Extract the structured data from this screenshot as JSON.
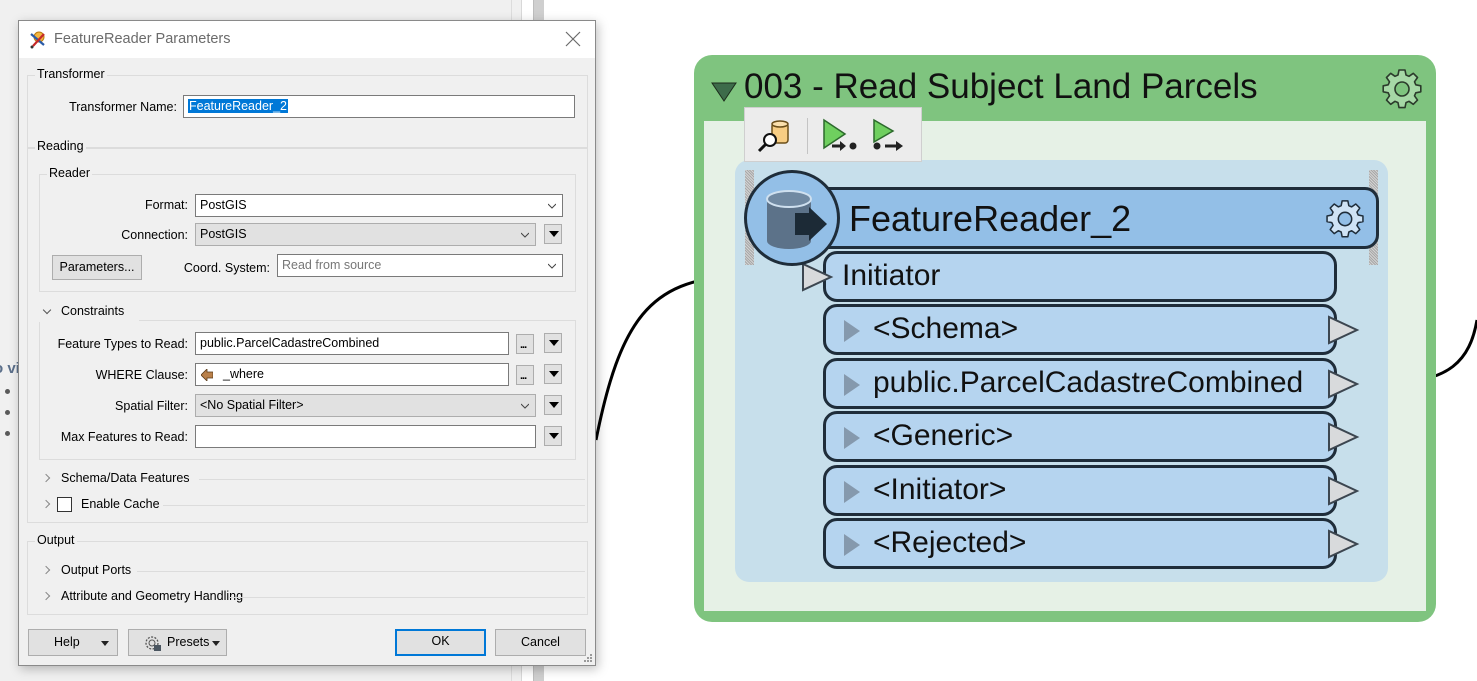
{
  "background": {
    "partial_text": "o vi",
    "bullet_count": 3
  },
  "dialog": {
    "title": "FeatureReader Parameters",
    "icon": "featurereader-app-icon",
    "close_icon": "close-icon",
    "transformer_group": {
      "label": "Transformer",
      "name_label": "Transformer Name:",
      "name_value": "FeatureReader_2"
    },
    "reading_group": {
      "label": "Reading",
      "reader_group": {
        "label": "Reader",
        "format_label": "Format:",
        "format_value": "PostGIS",
        "connection_label": "Connection:",
        "connection_value": "PostGIS",
        "parameters_button": "Parameters...",
        "coord_label": "Coord. System:",
        "coord_placeholder": "Read from source"
      },
      "constraints": {
        "label": "Constraints",
        "expanded": true,
        "feature_types_label": "Feature Types to Read:",
        "feature_types_value": "public.ParcelCadastreCombined",
        "where_label": "WHERE Clause:",
        "where_value": "_where",
        "spatial_filter_label": "Spatial Filter:",
        "spatial_filter_value": "<No Spatial Filter>",
        "max_features_label": "Max Features to Read:",
        "max_features_value": ""
      },
      "schema_section": "Schema/Data Features",
      "enable_cache": {
        "label": "Enable Cache",
        "checked": false
      }
    },
    "output_group": {
      "label": "Output",
      "output_ports": "Output Ports",
      "attribute_handling": "Attribute and Geometry Handling"
    },
    "footer": {
      "help": "Help",
      "presets": "Presets",
      "ok": "OK",
      "cancel": "Cancel"
    },
    "colors": {
      "accent": "#0078d7"
    }
  },
  "canvas": {
    "bookmark": {
      "title": "003 - Read Subject Land Parcels",
      "color": "#7fc47f"
    },
    "transformer": {
      "name": "FeatureReader_2",
      "input_port": "Initiator",
      "output_ports": [
        "<Schema>",
        "public.ParcelCadastreCombined",
        "<Generic>",
        "<Initiator>",
        "<Rejected>"
      ],
      "color": "#93bfe7"
    },
    "mini_toolbar": [
      {
        "icon": "inspect-data-icon"
      },
      {
        "icon": "run-to-this-icon"
      },
      {
        "icon": "run-from-this-icon"
      }
    ]
  }
}
